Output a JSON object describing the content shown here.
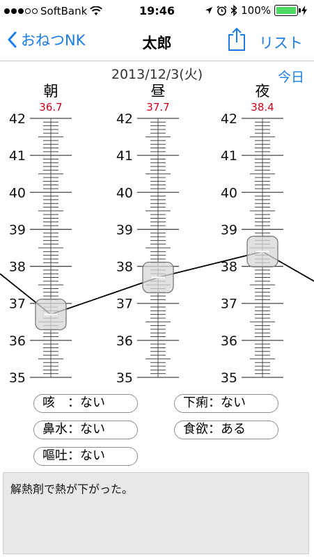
{
  "status_bar": {
    "carrier": "SoftBank",
    "signal_dots_filled": 3,
    "signal_dots_total": 5,
    "time": "19:46",
    "battery": "100%",
    "icons": [
      "wifi-icon",
      "location-icon",
      "alarm-icon",
      "bluetooth-icon",
      "battery-icon",
      "charging-icon"
    ]
  },
  "nav": {
    "back_label": "おねつNK",
    "title": "太郎",
    "list_label": "リスト",
    "share_icon": "share-icon",
    "back_icon": "chevron-left-icon"
  },
  "date": "2013/12/3(火)",
  "today_label": "今日",
  "chart_data": {
    "type": "line",
    "columns": [
      {
        "label": "朝",
        "value_label": "36.7",
        "value": 36.7
      },
      {
        "label": "昼",
        "value_label": "37.7",
        "value": 37.7
      },
      {
        "label": "夜",
        "value_label": "38.4",
        "value": 38.4
      }
    ],
    "ticks": [
      "42",
      "41",
      "40",
      "39",
      "38",
      "37",
      "36",
      "35"
    ],
    "ylim": [
      35,
      42
    ],
    "value_color": "#d0021b"
  },
  "symptoms": {
    "cough": "咳　：ない",
    "diarrhea": "下痢：ない",
    "runny_nose": "鼻水：ない",
    "appetite": "食欲：ある",
    "vomiting": "嘔吐：ない"
  },
  "memo": "解熱剤で熱が下がった。",
  "colors": {
    "accent": "#1a7dea",
    "value_red": "#d0021b",
    "battery_green": "#4cd964"
  }
}
